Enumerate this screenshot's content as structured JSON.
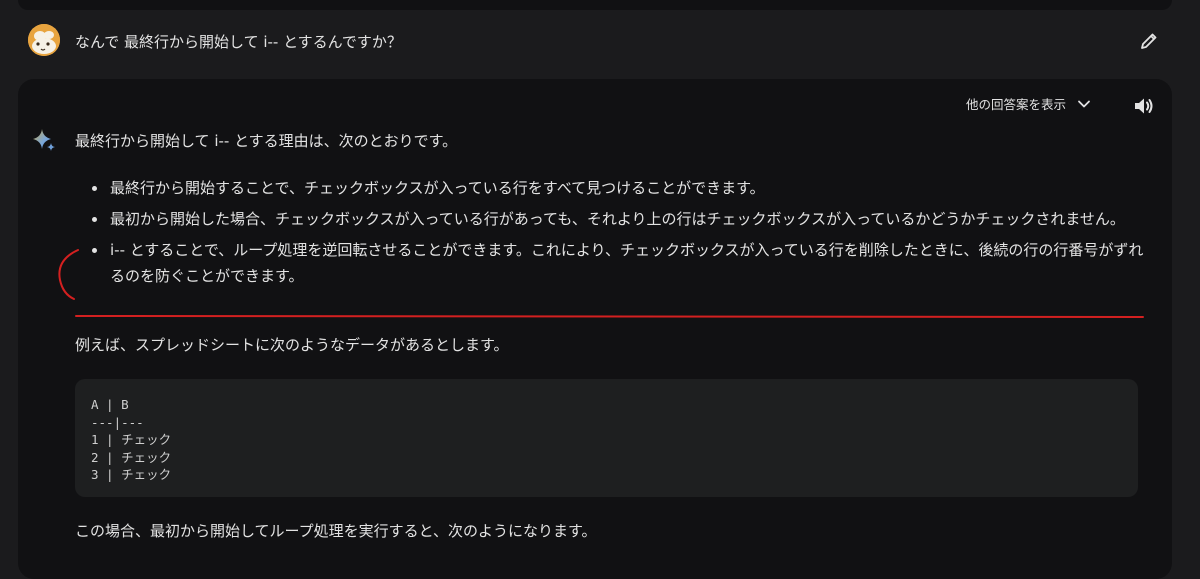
{
  "user_message": {
    "text": "なんで 最終行から開始して i-- とするんですか？"
  },
  "response": {
    "drafts_label": "他の回答案を表示",
    "intro": "最終行から開始して i-- とする理由は、次のとおりです。",
    "bullets": [
      "最終行から開始することで、チェックボックスが入っている行をすべて見つけることができます。",
      "最初から開始した場合、チェックボックスが入っている行があっても、それより上の行はチェックボックスが入っているかどうかチェックされません。",
      "i-- とすることで、ループ処理を逆回転させることができます。これにより、チェックボックスが入っている行を削除したときに、後続の行の行番号がずれるのを防ぐことができます。"
    ],
    "example_intro": "例えば、スプレッドシートに次のようなデータがあるとします。",
    "code_lines": [
      "A | B",
      "---|---",
      "1 | チェック",
      "2 | チェック",
      "3 | チェック"
    ],
    "after_code": "この場合、最初から開始してループ処理を実行すると、次のようになります。"
  },
  "icons": {
    "avatar": "user-avatar",
    "edit": "pencil-icon",
    "drafts_toggle": "chevron-down-icon",
    "speaker": "speaker-icon",
    "assistant": "sparkle-icon"
  },
  "colors": {
    "background": "#1b1b1d",
    "panel": "#111113",
    "code_block": "#1e1f20",
    "annotation": "#d42020",
    "text": "#e3e3e3"
  }
}
